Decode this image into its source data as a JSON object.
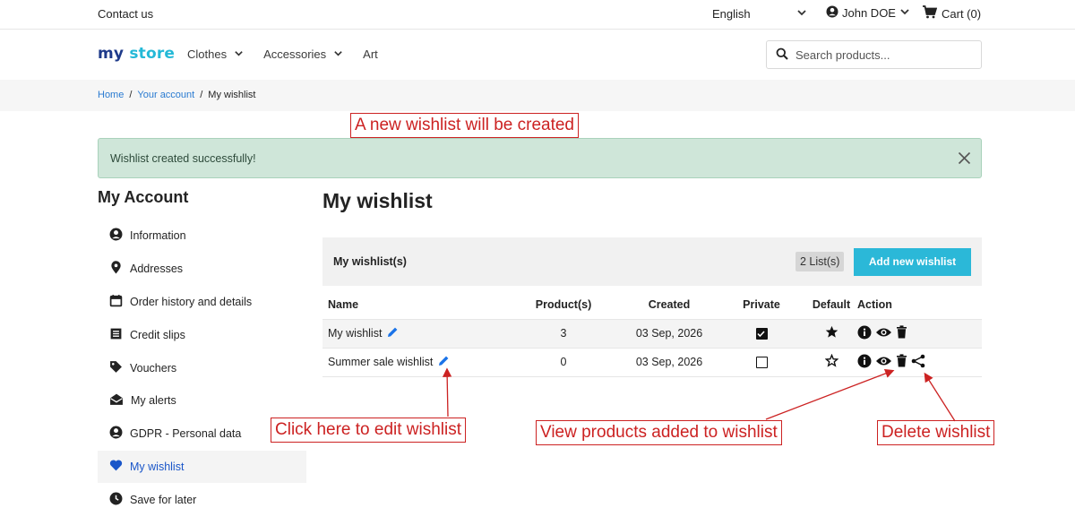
{
  "topbar": {
    "contact_label": "Contact us",
    "language_label": "English",
    "account_name": "John DOE",
    "cart_label": "Cart (0)"
  },
  "header": {
    "logo_part1": "my",
    "logo_part2": "store",
    "nav": [
      {
        "label": "Clothes",
        "has_dropdown": true
      },
      {
        "label": "Accessories",
        "has_dropdown": true
      },
      {
        "label": "Art",
        "has_dropdown": false
      }
    ],
    "search_placeholder": "Search products..."
  },
  "breadcrumb": {
    "items": [
      "Home",
      "Your account",
      "My wishlist"
    ],
    "separator": "/"
  },
  "alert": {
    "message": "Wishlist created successfully!"
  },
  "sidebar": {
    "title": "My Account",
    "items": [
      {
        "label": "Information",
        "icon": "user-circle-icon"
      },
      {
        "label": "Addresses",
        "icon": "location-pin-icon"
      },
      {
        "label": "Order history and details",
        "icon": "calendar-icon"
      },
      {
        "label": "Credit slips",
        "icon": "list-icon"
      },
      {
        "label": "Vouchers",
        "icon": "tag-icon"
      },
      {
        "label": "My alerts",
        "icon": "envelope-open-icon"
      },
      {
        "label": "GDPR - Personal data",
        "icon": "user-circle-icon"
      },
      {
        "label": "My wishlist",
        "icon": "heart-icon",
        "active": true
      },
      {
        "label": "Save for later",
        "icon": "clock-icon"
      }
    ]
  },
  "main": {
    "title": "My wishlist",
    "panel_label": "My wishlist(s)",
    "list_count": "2 List(s)",
    "add_button": "Add new wishlist",
    "columns": [
      "Name",
      "Product(s)",
      "Created",
      "Private",
      "Default",
      "Action"
    ],
    "rows": [
      {
        "name": "My wishlist",
        "products": "3",
        "created": "03 Sep, 2026",
        "private": true,
        "default": true,
        "shareable": false
      },
      {
        "name": "Summer sale wishlist",
        "products": "0",
        "created": "03 Sep, 2026",
        "private": false,
        "default": false,
        "shareable": true
      }
    ]
  },
  "annotations": {
    "created_note": "A new wishlist will be created",
    "edit_note": "Click here to edit wishlist",
    "view_note": "View products added to wishlist",
    "delete_note": "Delete wishlist"
  },
  "colors": {
    "accent": "#2bb8d8",
    "link": "#2a7bd1",
    "active_sidebar": "#1a56c9",
    "alert_bg": "#cfe6d9",
    "annotation": "#cc2222"
  }
}
